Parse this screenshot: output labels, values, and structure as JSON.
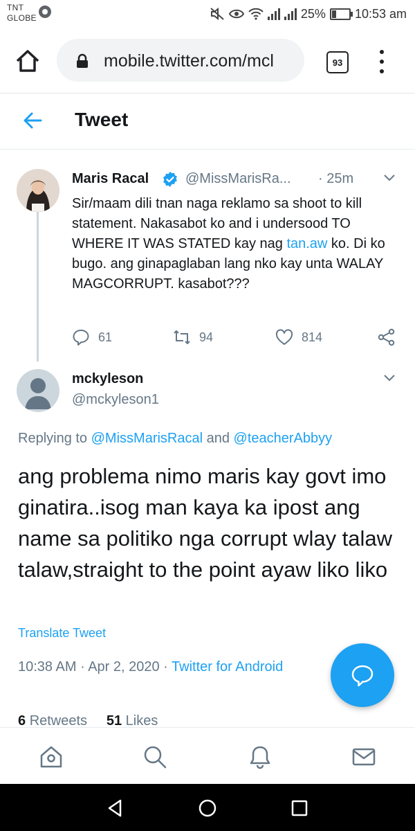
{
  "status_bar": {
    "carrier_line1": "TNT",
    "carrier_line2": "GLOBE",
    "battery": "25%",
    "time": "10:53 am"
  },
  "browser": {
    "url": "mobile.twitter.com/mcl",
    "tab_count": "93"
  },
  "header": {
    "title": "Tweet"
  },
  "parent_tweet": {
    "name": "Maris Racal",
    "handle": "@MissMarisRa...",
    "time": "· 25m",
    "text_part1": "Sir/maam dili tnan naga reklamo sa shoot to kill statement. Nakasabot ko and  i undersood TO WHERE IT WAS STATED kay nag ",
    "text_link": "tan.aw",
    "text_part2": " ko. Di ko bugo. ang ginapaglaban lang nko kay unta WALAY MAGCORRUPT. kasabot???",
    "replies": "61",
    "retweets": "94",
    "likes": "814"
  },
  "reply_tweet": {
    "name": "mckyleson",
    "handle": "@mckyleson1",
    "replying_prefix": "Replying to ",
    "replying_user1": "@MissMarisRacal",
    "replying_and": " and ",
    "replying_user2": "@teacherAbbyy",
    "text": "ang problema nimo maris kay govt imo ginatira..isog man kaya ka ipost ang name sa politiko nga corrupt wlay talaw talaw,straight to the point ayaw liko liko",
    "translate": "Translate Tweet",
    "time": "10:38 AM",
    "date": "Apr 2, 2020",
    "source": "Twitter for Android",
    "retweet_count": "6",
    "retweet_label": "Retweets",
    "like_count": "51",
    "like_label": "Likes"
  },
  "icons": {
    "accent": "#1da1f2",
    "nav": [
      "home-icon",
      "search-icon",
      "notifications-icon",
      "messages-icon"
    ]
  }
}
